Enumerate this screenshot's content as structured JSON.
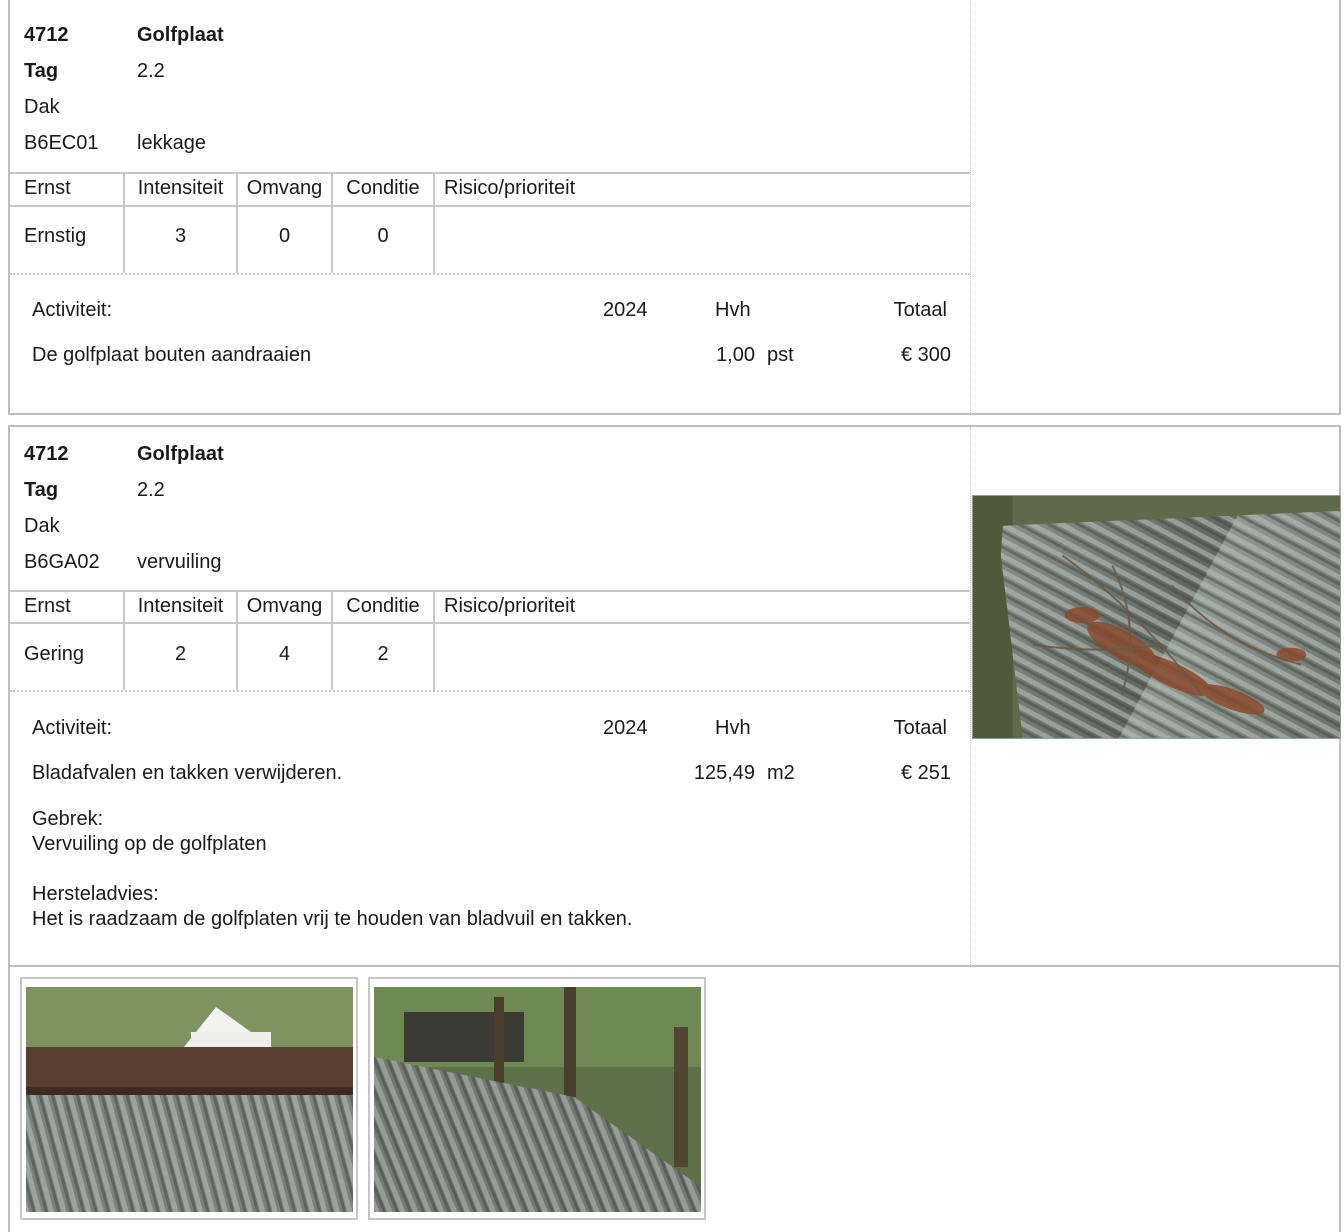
{
  "items": [
    {
      "code": "4712",
      "title": "Golfplaat",
      "tag_label": "Tag",
      "tag_value": "2.2",
      "location": "Dak",
      "defect_code": "B6EC01",
      "defect_name": "lekkage",
      "table_headers": [
        "Ernst",
        "Intensiteit",
        "Omvang",
        "Conditie",
        "Risico/prioriteit"
      ],
      "table_values": [
        "Ernstig",
        "3",
        "0",
        "0",
        ""
      ],
      "activity_label": "Activiteit:",
      "year_label": "2024",
      "qty_label": "Hvh",
      "total_label": "Totaal",
      "activity": "De golfplaat bouten aandraaien",
      "qty": "1,00",
      "unit": "pst",
      "total": "€ 300"
    },
    {
      "code": "4712",
      "title": "Golfplaat",
      "tag_label": "Tag",
      "tag_value": "2.2",
      "location": "Dak",
      "defect_code": "B6GA02",
      "defect_name": "vervuiling",
      "table_headers": [
        "Ernst",
        "Intensiteit",
        "Omvang",
        "Conditie",
        "Risico/prioriteit"
      ],
      "table_values": [
        "Gering",
        "2",
        "4",
        "2",
        ""
      ],
      "activity_label": "Activiteit:",
      "year_label": "2024",
      "qty_label": "Hvh",
      "total_label": "Totaal",
      "activity": "Bladafvalen en takken verwijderen.",
      "qty": "125,49",
      "unit": "m2",
      "total": "€ 251",
      "gebrek_label": "Gebrek:",
      "gebrek_text": "Vervuiling op de golfplaten",
      "advies_label": "Hersteladvies:",
      "advies_text": "Het is raadzaam de golfplaten vrij te houden van bladvuil en takken."
    }
  ],
  "colors": {
    "accent_bar": "#3cb043",
    "border": "#bdbdbd",
    "text": "#1a1a1a"
  }
}
